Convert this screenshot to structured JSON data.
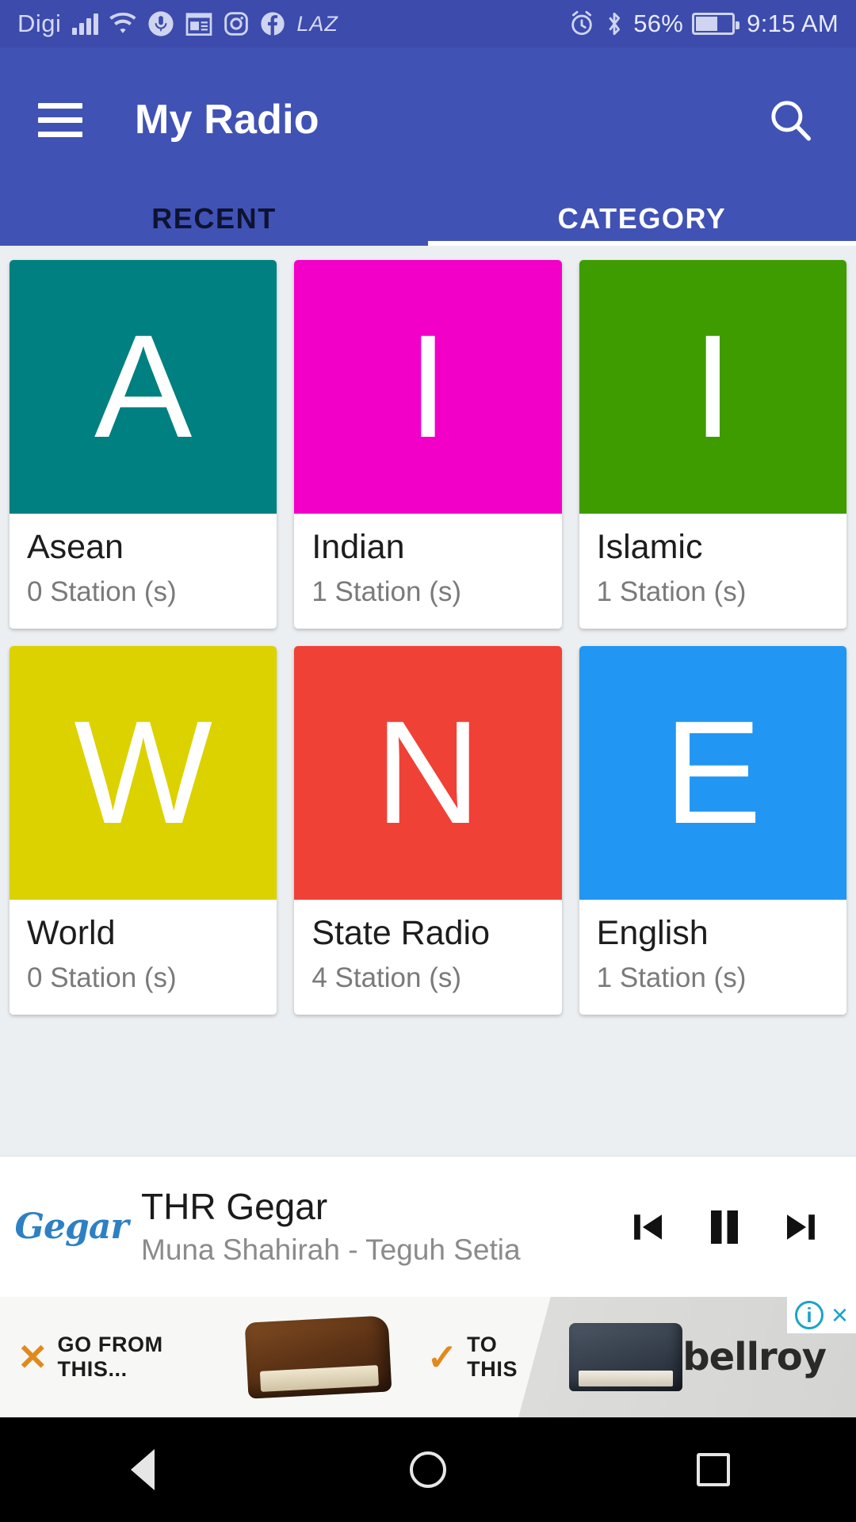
{
  "status_bar": {
    "carrier": "Digi",
    "battery_percent": "56%",
    "time": "9:15 AM",
    "left_icons": [
      "signal-icon",
      "wifi-icon",
      "voice-assistant-icon",
      "news-icon",
      "instagram-icon",
      "facebook-icon",
      "lazada-icon"
    ],
    "right_icons": [
      "alarm-icon",
      "bluetooth-icon",
      "battery-icon"
    ],
    "lazada_label": "LAZ",
    "background": "#3c4bac"
  },
  "app_bar": {
    "title": "My Radio",
    "menu_icon": "hamburger-icon",
    "search_icon": "search-icon",
    "background": "#4152b5"
  },
  "tabs": {
    "items": [
      {
        "label": "RECENT",
        "active": false
      },
      {
        "label": "CATEGORY",
        "active": true
      }
    ],
    "active_index": 1,
    "indicator_color": "#ffffff"
  },
  "categories": [
    {
      "letter": "A",
      "name": "Asean",
      "stations": "0 Station (s)",
      "color": "#008080"
    },
    {
      "letter": "I",
      "name": "Indian",
      "stations": "1 Station (s)",
      "color": "#f200c8"
    },
    {
      "letter": "I",
      "name": "Islamic",
      "stations": "1 Station (s)",
      "color": "#3e9c00"
    },
    {
      "letter": "W",
      "name": "World",
      "stations": "0 Station (s)",
      "color": "#dbd200"
    },
    {
      "letter": "N",
      "name": "State Radio",
      "stations": "4 Station (s)",
      "color": "#ef4136"
    },
    {
      "letter": "E",
      "name": "English",
      "stations": "1 Station (s)",
      "color": "#2196f3"
    }
  ],
  "player": {
    "logo_text": "Gegar",
    "title": "THR Gegar",
    "artist": "Muna Shahirah - Teguh Setia",
    "previous_icon": "skip-previous-icon",
    "play_pause_icon": "pause-icon",
    "next_icon": "skip-next-icon",
    "state": "playing"
  },
  "ad": {
    "left_text": "GO FROM THIS...",
    "right_text": "TO THIS",
    "brand": "bellroy",
    "info_label": "i",
    "close_label": "×",
    "x_mark": "✕",
    "check_mark": "✓"
  },
  "nav_bar": {
    "back_icon": "back-triangle-icon",
    "home_icon": "home-circle-icon",
    "recents_icon": "recents-square-icon"
  }
}
